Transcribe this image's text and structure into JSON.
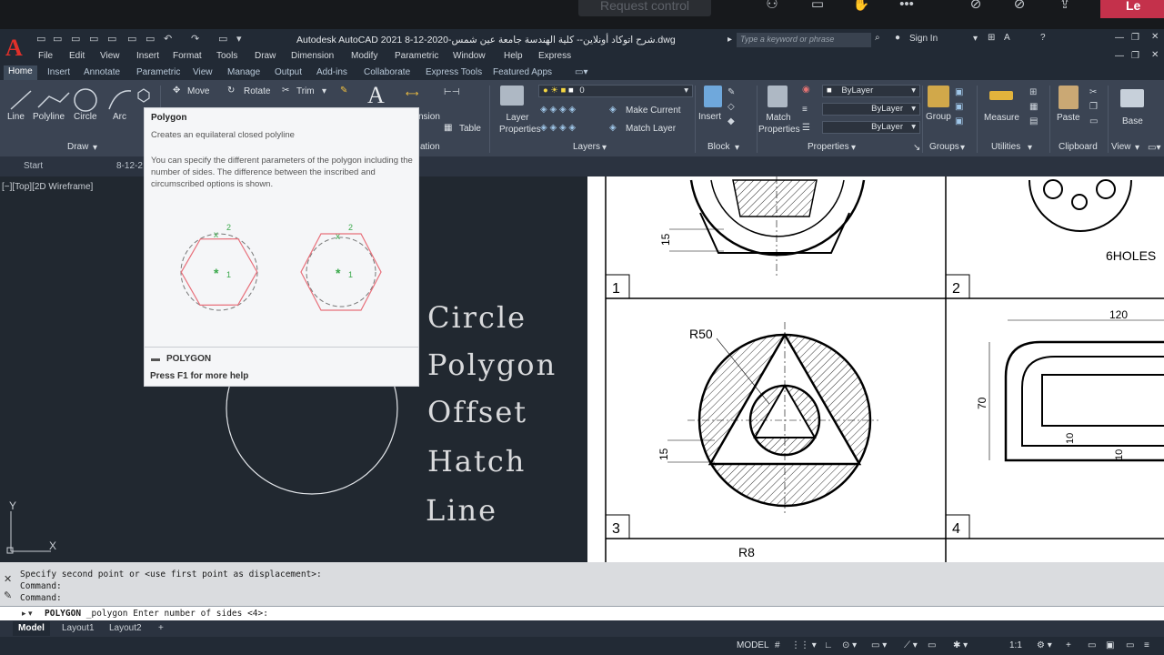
{
  "meeting": {
    "request_control": "Request control",
    "leave": "Le"
  },
  "window": {
    "title": "Autodesk AutoCAD 2021    8-12-2020-شرح اتوكاد أونلاين-- كلية الهندسة جامعة عين شمس.dwg",
    "search_placeholder": "Type a keyword or phrase",
    "sign_in": "Sign In"
  },
  "menubar": [
    "File",
    "Edit",
    "View",
    "Insert",
    "Format",
    "Tools",
    "Draw",
    "Dimension",
    "Modify",
    "Parametric",
    "Window",
    "Help",
    "Express"
  ],
  "ribbon_tabs": [
    "Home",
    "Insert",
    "Annotate",
    "Parametric",
    "View",
    "Manage",
    "Output",
    "Add-ins",
    "Collaborate",
    "Express Tools",
    "Featured Apps"
  ],
  "ribbon": {
    "draw": {
      "line": "Line",
      "polyline": "Polyline",
      "circle": "Circle",
      "arc": "Arc",
      "panel": "Draw"
    },
    "modify": {
      "move": "Move",
      "rotate": "Rotate",
      "trim": "Trim"
    },
    "annotation": {
      "dimension": "nsion",
      "table": "Table",
      "panel": "ation"
    },
    "layers": {
      "layer_properties": "Layer Properties",
      "layer_name": "0",
      "make_current": "Make Current",
      "match_layer": "Match Layer",
      "panel": "Layers"
    },
    "block": {
      "insert": "Insert",
      "panel": "Block"
    },
    "properties": {
      "match_properties": "Match Properties",
      "bylayer1": "ByLayer",
      "bylayer2": "ByLayer",
      "bylayer3": "ByLayer",
      "panel": "Properties"
    },
    "groups": {
      "group": "Group",
      "panel": "Groups"
    },
    "utilities": {
      "measure": "Measure",
      "panel": "Utilities"
    },
    "clipboard": {
      "paste": "Paste",
      "panel": "Clipboard"
    },
    "view": {
      "base": "Base",
      "panel": "View"
    }
  },
  "file_tabs": {
    "start": "Start",
    "drawing": "8-12-2"
  },
  "viewport": {
    "label": "[−][Top][2D Wireframe]"
  },
  "words": [
    "Circle",
    "Polygon",
    "Offset",
    "Hatch",
    "Line"
  ],
  "tooltip": {
    "title": "Polygon",
    "desc": "Creates an equilateral closed polyline",
    "body": "You can specify the different parameters of the polygon including the number of sides. The difference between the inscribed and circumscribed options is shown.",
    "command": "POLYGON",
    "help": "Press F1 for more help"
  },
  "sheet": {
    "labels": [
      "1",
      "2",
      "3",
      "4"
    ],
    "dims": {
      "d15a": "15",
      "holes": "6HOLES",
      "r50": "R50",
      "d120": "120",
      "d70": "70",
      "d15b": "15",
      "d10a": "10",
      "d10b": "10",
      "r8": "R8"
    }
  },
  "command": {
    "lines": [
      "Specify second point or <use first point as displacement>:",
      "Command:",
      "Command:"
    ],
    "prompt_cmd": "POLYGON",
    "prompt_text": " _polygon Enter number of sides <4>:"
  },
  "layouts": [
    "Model",
    "Layout1",
    "Layout2"
  ],
  "status": {
    "model": "MODEL",
    "scale": "1:1"
  },
  "colors": {
    "ribbon": "#3b4453",
    "titlebar": "#222a35",
    "accent_red": "#e0302a",
    "leave_red": "#c4314b"
  }
}
